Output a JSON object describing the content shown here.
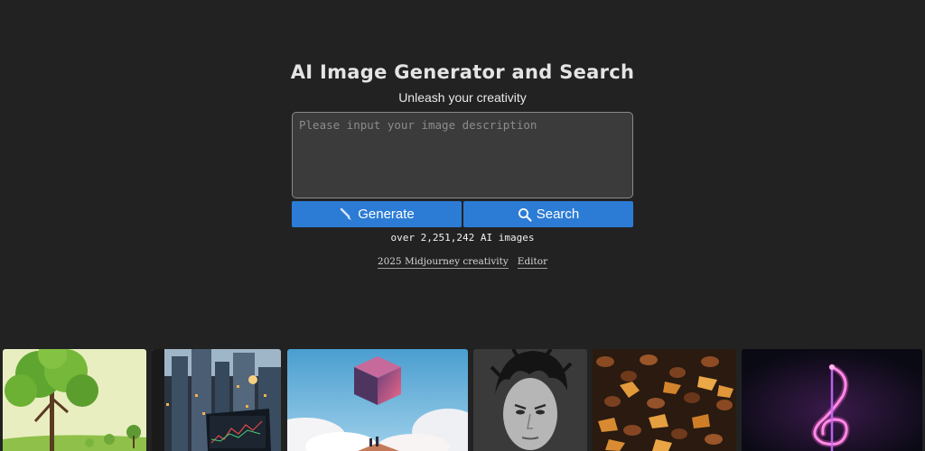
{
  "hero": {
    "title": "AI Image Generator and Search",
    "subtitle": "Unleash your creativity"
  },
  "prompt": {
    "placeholder": "Please input your image description",
    "value": ""
  },
  "actions": {
    "generate_label": "Generate",
    "generate_icon": "brush-icon",
    "search_label": "Search",
    "search_icon": "search-icon",
    "accent_color": "#2c7cd6"
  },
  "stats": {
    "count_text": "over 2,251,242 AI images"
  },
  "links": [
    {
      "label": "2025 Midjourney creativity"
    },
    {
      "label": "Editor"
    }
  ],
  "gallery": [
    {
      "subject": "tree-image"
    },
    {
      "subject": "city-laptop-image"
    },
    {
      "subject": "floating-cube-image"
    },
    {
      "subject": "portrait-image"
    },
    {
      "subject": "coffee-leaves-image"
    },
    {
      "subject": "neon-music-note-image"
    }
  ]
}
